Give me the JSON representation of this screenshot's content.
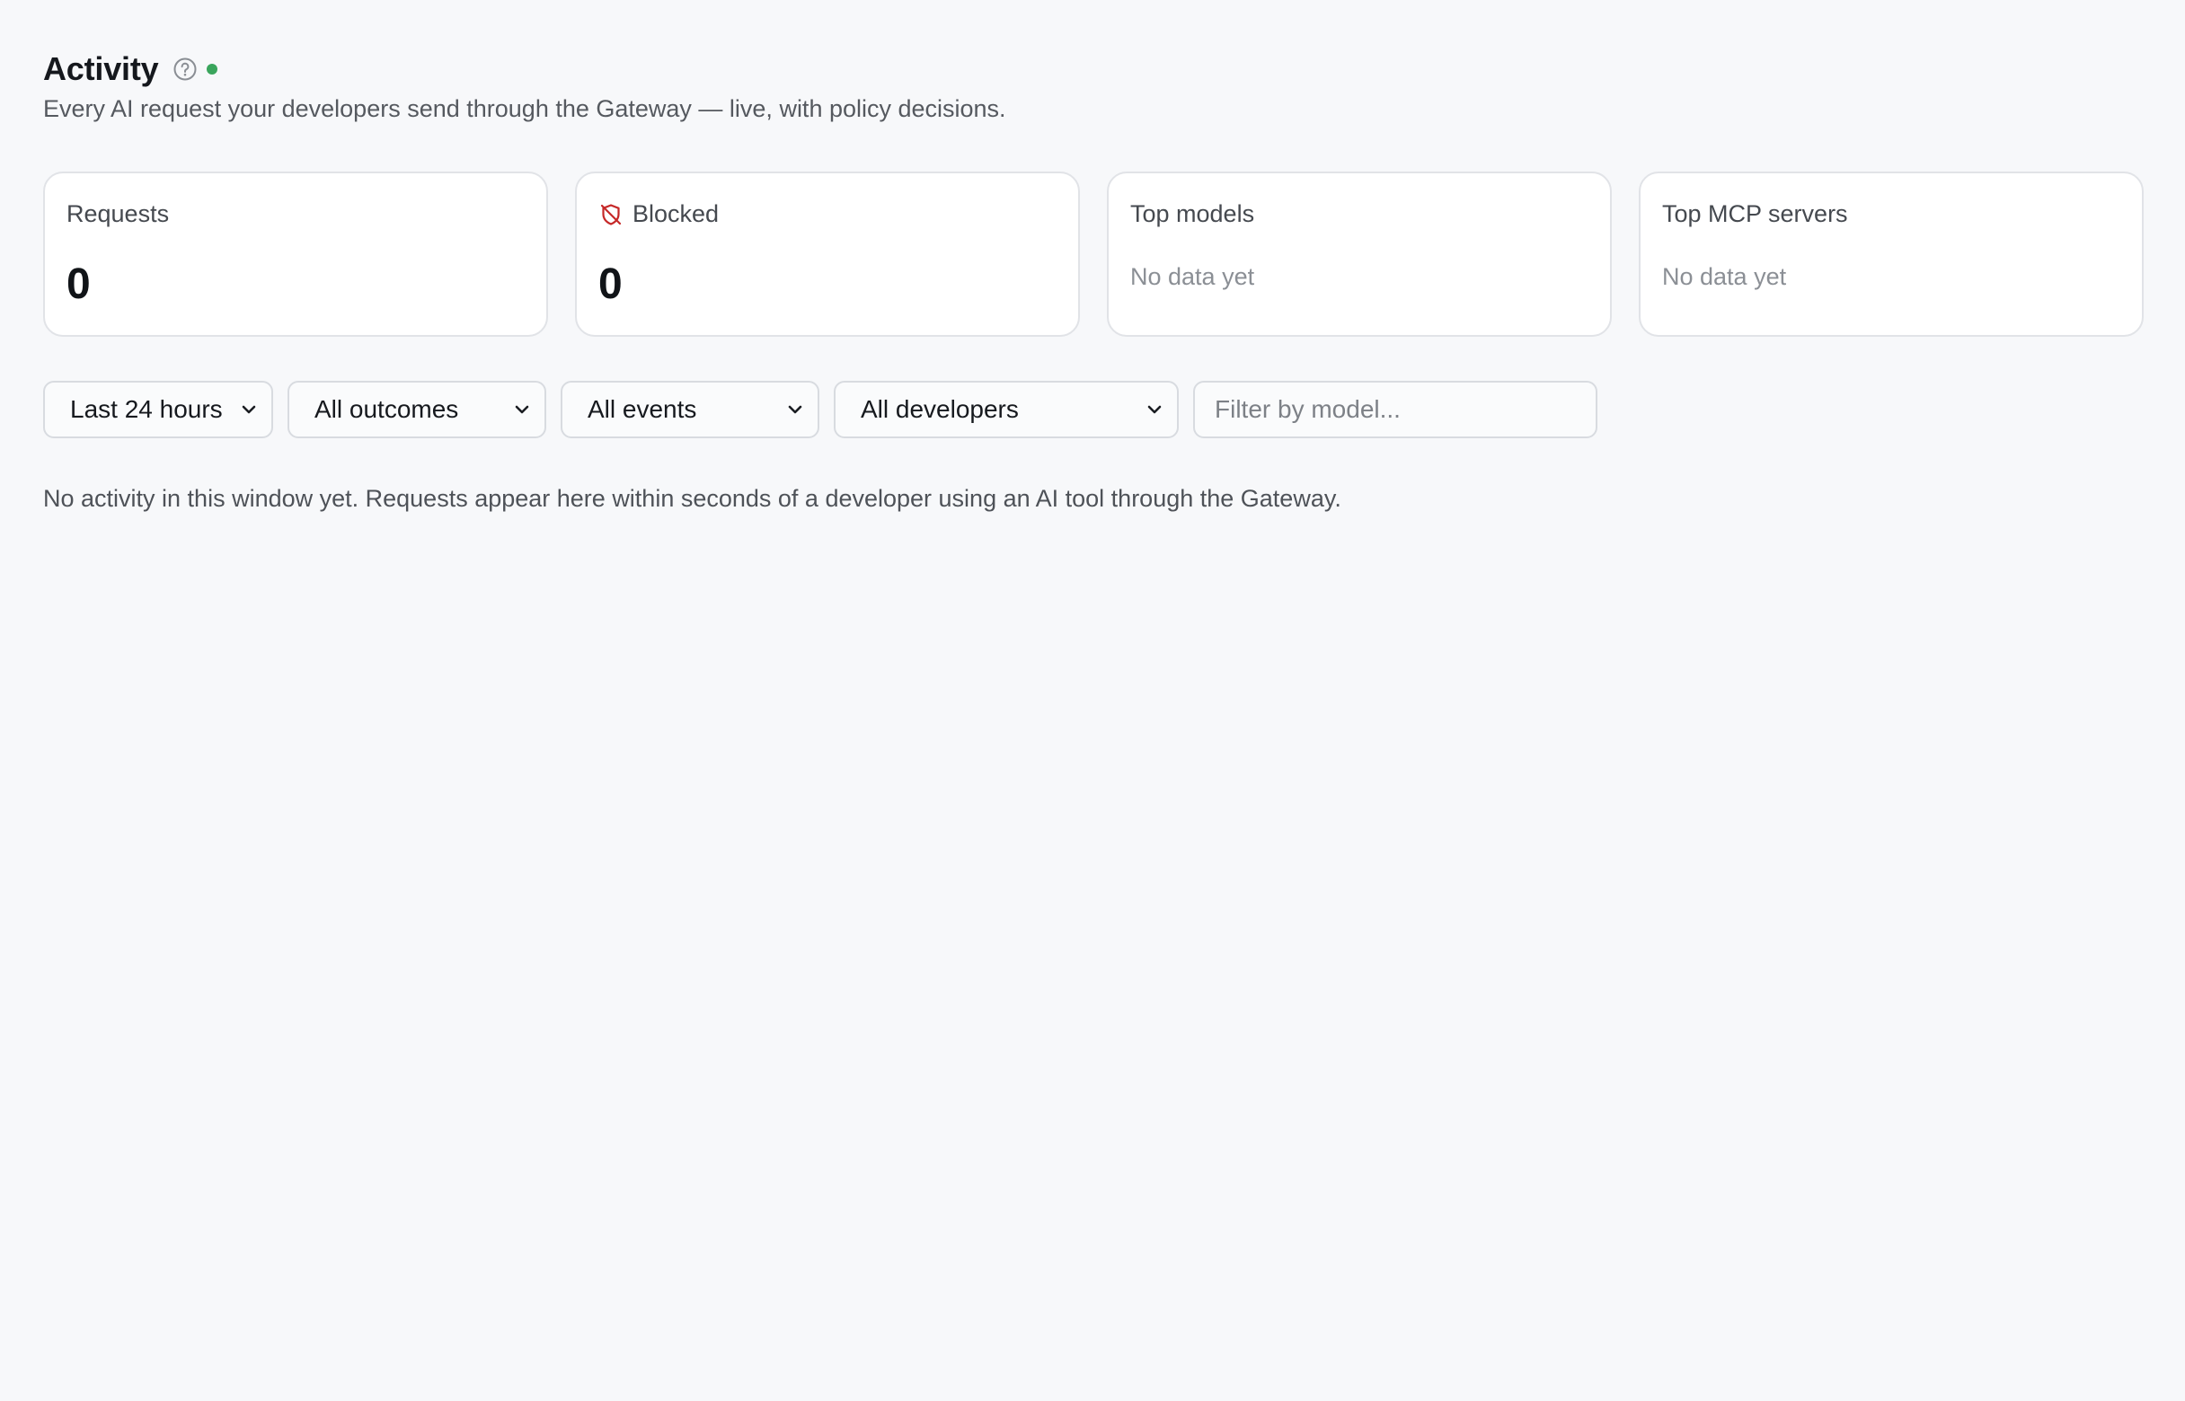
{
  "header": {
    "title": "Activity",
    "subtitle": "Every AI request your developers send through the Gateway — live, with policy decisions.",
    "help_icon": "question-circle-icon",
    "live_status_color": "#3aa55c"
  },
  "stats": {
    "requests": {
      "label": "Requests",
      "value": "0"
    },
    "blocked": {
      "label": "Blocked",
      "value": "0",
      "icon": "shield-off-icon",
      "icon_color": "#c62828"
    },
    "top_models": {
      "label": "Top models",
      "empty_text": "No data yet"
    },
    "top_mcp_servers": {
      "label": "Top MCP servers",
      "empty_text": "No data yet"
    }
  },
  "filters": {
    "time_range": {
      "selected": "Last 24 hours"
    },
    "outcome": {
      "selected": "All outcomes"
    },
    "event": {
      "selected": "All events"
    },
    "developer": {
      "selected": "All developers"
    },
    "model": {
      "placeholder": "Filter by model...",
      "value": ""
    }
  },
  "empty_state": {
    "message": "No activity in this window yet. Requests appear here within seconds of a developer using an AI tool through the Gateway."
  }
}
